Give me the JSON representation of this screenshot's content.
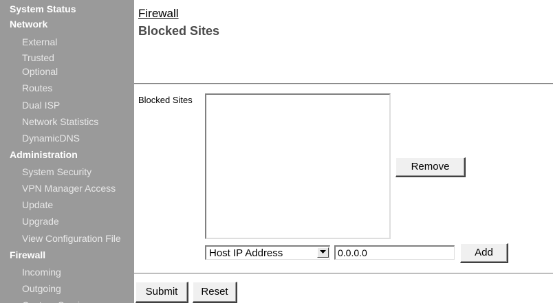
{
  "sidebar": {
    "items": [
      {
        "label": "System Status",
        "kind": "section"
      },
      {
        "label": "Network",
        "kind": "section"
      },
      {
        "label": "External",
        "kind": "sub"
      },
      {
        "label": "Trusted",
        "kind": "sub"
      },
      {
        "label": "Optional",
        "kind": "sub"
      },
      {
        "label": "Routes",
        "kind": "sub"
      },
      {
        "label": "Dual ISP",
        "kind": "sub"
      },
      {
        "label": "Network Statistics",
        "kind": "sub"
      },
      {
        "label": "DynamicDNS",
        "kind": "sub"
      },
      {
        "label": "Administration",
        "kind": "section"
      },
      {
        "label": "System Security",
        "kind": "sub"
      },
      {
        "label": "VPN Manager Access",
        "kind": "sub"
      },
      {
        "label": "Update",
        "kind": "sub"
      },
      {
        "label": "Upgrade",
        "kind": "sub"
      },
      {
        "label": "View Configuration File",
        "kind": "sub"
      },
      {
        "label": "Firewall",
        "kind": "section"
      },
      {
        "label": "Incoming",
        "kind": "sub"
      },
      {
        "label": "Outgoing",
        "kind": "sub"
      },
      {
        "label": "Custom Services",
        "kind": "sub"
      }
    ]
  },
  "header": {
    "breadcrumb": "Firewall",
    "title": "Blocked Sites"
  },
  "form": {
    "blocked_sites_label": "Blocked Sites",
    "blocked_sites": [],
    "remove_label": "Remove",
    "address_type": "Host IP Address",
    "address_value": "0.0.0.0",
    "add_label": "Add",
    "submit_label": "Submit",
    "reset_label": "Reset"
  },
  "colors": {
    "sidebar_bg": "#9a9a9a",
    "section_text": "#ffffff",
    "sub_text": "#e8e8e8",
    "title_text": "#4a4a4a"
  }
}
